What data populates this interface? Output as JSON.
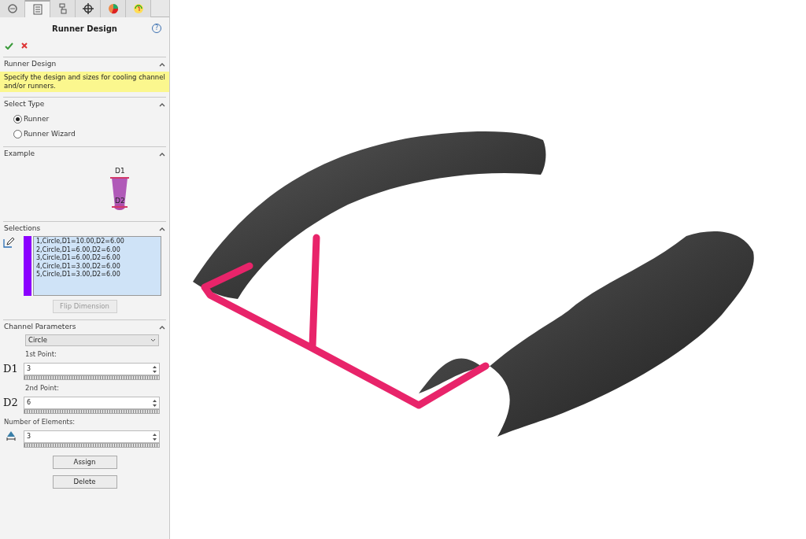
{
  "tabs": [
    {
      "selected": false
    },
    {
      "selected": true
    },
    {
      "selected": false
    },
    {
      "selected": false
    },
    {
      "selected": false
    },
    {
      "selected": false
    }
  ],
  "panel": {
    "title": "Runner Design",
    "help": "?"
  },
  "runner_design": {
    "heading": "Runner Design",
    "message": "Specify the design and sizes for cooling channel and/or runners.",
    "expanded": true
  },
  "select_type": {
    "heading": "Select Type",
    "expanded": true,
    "options": [
      {
        "label": "Runner",
        "selected": true
      },
      {
        "label": "Runner Wizard",
        "selected": false
      }
    ]
  },
  "example": {
    "heading": "Example",
    "expanded": true,
    "labels": [
      "D1",
      "D2"
    ]
  },
  "selections": {
    "heading": "Selections",
    "expanded": true,
    "color": "#8b00ff",
    "items": [
      "1,Circle,D1=10.00,D2=6.00",
      "2,Circle,D1=6.00,D2=6.00",
      "3,Circle,D1=6.00,D2=6.00",
      "4,Circle,D1=3.00,D2=6.00",
      "5,Circle,D1=3.00,D2=6.00"
    ],
    "flip_button": {
      "label": "Flip Dimension",
      "disabled": true
    }
  },
  "channel_parameters": {
    "heading": "Channel Parameters",
    "expanded": true,
    "shape": "Circle",
    "fields": [
      {
        "kind": "d",
        "caption": "1st Point:",
        "tag": "D1",
        "value": "3"
      },
      {
        "kind": "d",
        "caption": "2nd Point:",
        "tag": "D2",
        "value": "6"
      },
      {
        "kind": "count",
        "caption": "Number of Elements:",
        "value": "3"
      }
    ],
    "buttons": [
      "Assign",
      "Delete"
    ]
  }
}
